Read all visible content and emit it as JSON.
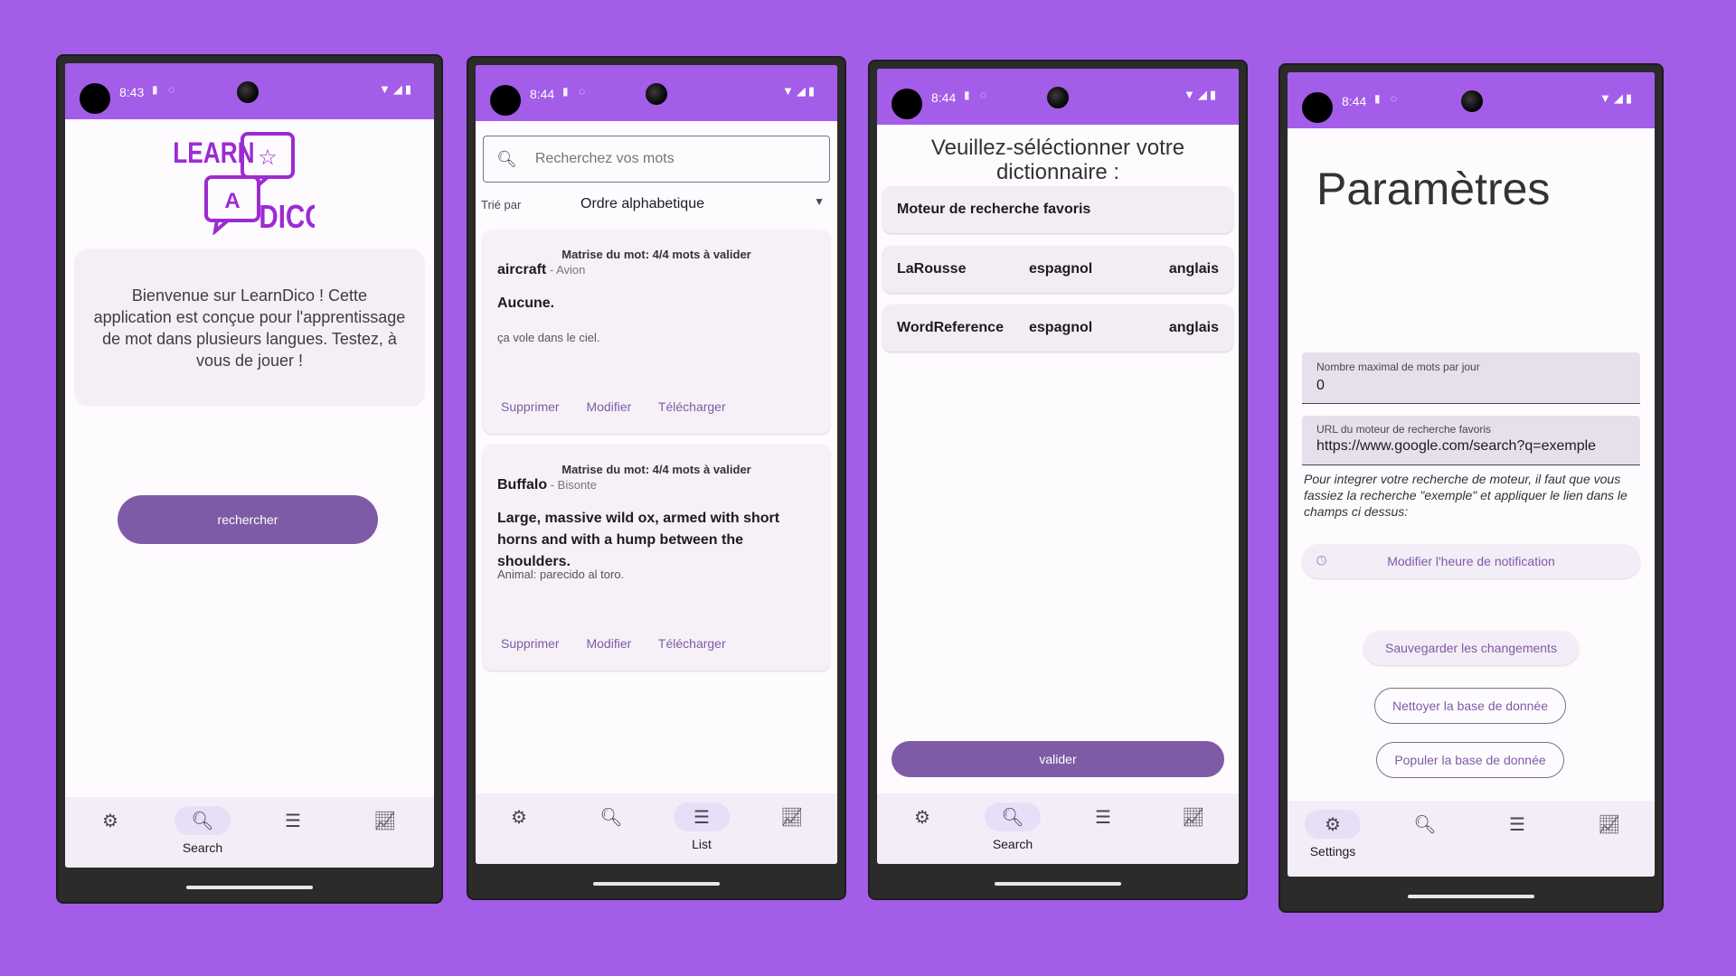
{
  "status": {
    "time_1": "8:43",
    "time_2": "8:44",
    "time_3": "8:44",
    "time_4": "8:44"
  },
  "nav": {
    "settings_label": "Settings",
    "search_label": "Search",
    "list_label": "List",
    "settings_icon": "gear-icon",
    "search_icon": "search-icon",
    "list_icon": "list-icon",
    "stats_icon": "chart-icon"
  },
  "home": {
    "logo_learn": "LEARN",
    "logo_a": "A",
    "logo_dico": "DICO",
    "welcome_text": "Bienvenue sur LearnDico ! Cette application est conçue pour l'apprentissage de mot dans plusieurs langues. Testez, à vous de jouer !",
    "search_button": "rechercher"
  },
  "list": {
    "search_placeholder": "Recherchez vos mots",
    "sort_label": "Trié par",
    "sort_value": "Ordre alphabetique",
    "cards": [
      {
        "mastery": "Matrise du mot: 4/4 mots à valider",
        "word": "aircraft",
        "translation": " - Avion",
        "definition": "Aucune.",
        "example": "ça vole dans le ciel.",
        "delete": "Supprimer",
        "edit": "Modifier",
        "download": "Télécharger"
      },
      {
        "mastery": "Matrise du mot: 4/4 mots à valider",
        "word": "Buffalo",
        "translation": " - Bisonte",
        "definition": "Large, massive wild ox, armed with short horns and with a hump between the shoulders.",
        "example": "Animal: parecido al toro.",
        "delete": "Supprimer",
        "edit": "Modifier",
        "download": "Télécharger"
      }
    ]
  },
  "dictionary": {
    "title": "Veuillez-séléctionner votre dictionnaire :",
    "favorite": "Moteur de recherche favoris",
    "rows": [
      {
        "name": "LaRousse",
        "from": "espagnol",
        "to": "anglais"
      },
      {
        "name": "WordReference",
        "from": "espagnol",
        "to": "anglais"
      }
    ],
    "validate_button": "valider"
  },
  "settings": {
    "title": "Paramètres",
    "max_words_label": "Nombre maximal de mots par jour",
    "max_words_value": "0",
    "url_label": "URL du moteur de recherche favoris",
    "url_value": "https://www.google.com/search?q=exemple",
    "help_text": "Pour integrer votre recherche de moteur, il faut que vous fassiez la recherche \"exemple\" et appliquer le lien dans le champs ci dessus:",
    "notification_button": "Modifier l'heure de notification",
    "save_button": "Sauvegarder les changements",
    "clean_button": "Nettoyer la base de donnée",
    "populate_button": "Populer la base de donnée"
  },
  "colors": {
    "background": "#a35de8",
    "primary": "#7e5ba6",
    "surface": "#fefbff",
    "nav_active": "#e8def8"
  }
}
